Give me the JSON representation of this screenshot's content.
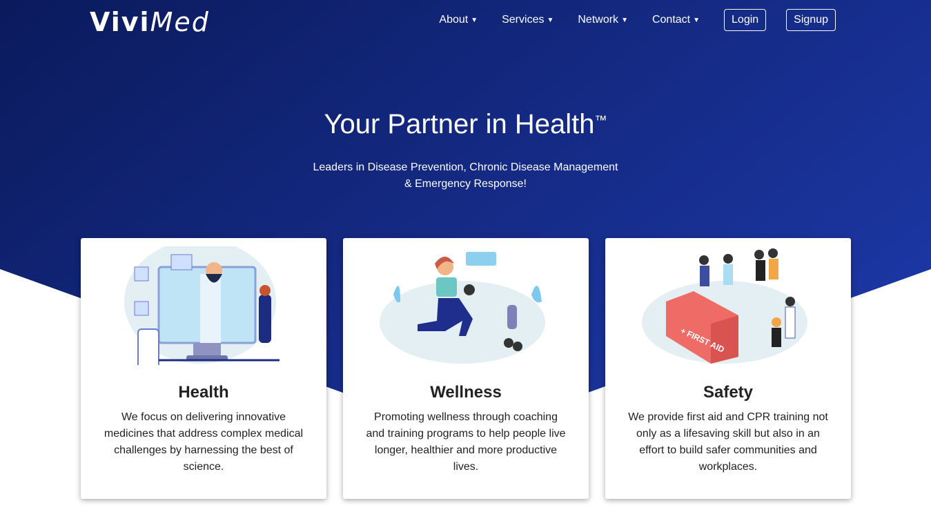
{
  "brand": {
    "bold": "Vivi",
    "light": "Med"
  },
  "nav": {
    "items": [
      {
        "label": "About"
      },
      {
        "label": "Services"
      },
      {
        "label": "Network"
      },
      {
        "label": "Contact"
      }
    ],
    "login": "Login",
    "signup": "Signup"
  },
  "hero": {
    "title": "Your Partner in Health",
    "tm": "™",
    "subtitle_line1": "Leaders in Disease Prevention, Chronic Disease Management",
    "subtitle_line2": "& Emergency Response!"
  },
  "cards": [
    {
      "title": "Health",
      "text": "We focus on delivering innovative medicines that address complex medical challenges by harnessing the best of science."
    },
    {
      "title": "Wellness",
      "text": "Promoting wellness through coaching and training programs to help people live longer, healthier and more productive lives."
    },
    {
      "title": "Safety",
      "text": "We provide first aid and CPR training not only as a lifesaving skill but also in an effort to build safer communities and workplaces.",
      "illustration_label": "FIRST AID"
    }
  ],
  "colors": {
    "hero_dark": "#0b1a5c",
    "hero_light": "#1a35a0"
  }
}
